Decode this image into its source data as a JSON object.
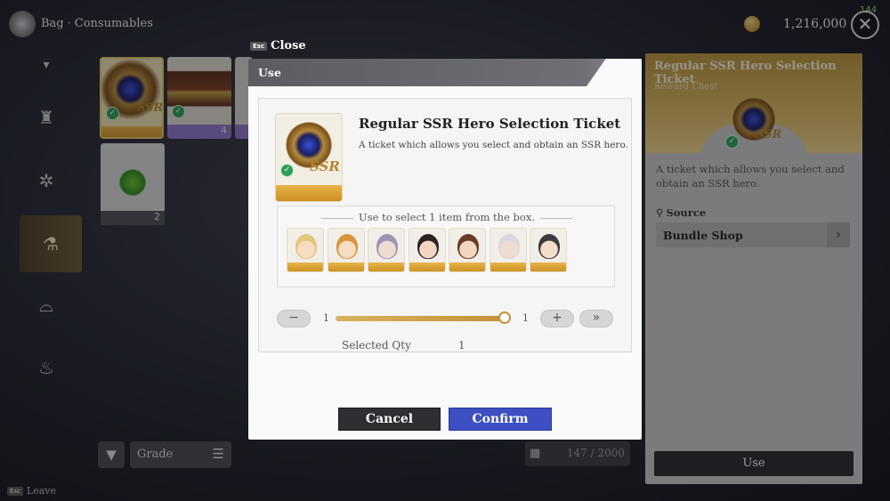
{
  "header": {
    "breadcrumb_root": "Bag",
    "breadcrumb_separator": "·",
    "breadcrumb_current": "Consumables",
    "gold_amount": "1,216,000",
    "exit_counter": "144",
    "exit_glyph": "✕"
  },
  "sidebar": {
    "items": [
      {
        "icon": "chevron-down-icon",
        "glyph": "▾"
      },
      {
        "icon": "armor-icon",
        "glyph": "♜"
      },
      {
        "icon": "gear-icon",
        "glyph": "✲"
      },
      {
        "icon": "potion-icon",
        "glyph": "⚗"
      },
      {
        "icon": "cloche-icon",
        "glyph": "⌓"
      },
      {
        "icon": "bag-icon",
        "glyph": "♨"
      }
    ]
  },
  "inventory": {
    "items": [
      {
        "name": "ssr-ticket",
        "qty": "",
        "selected": true,
        "badge": "SSR"
      },
      {
        "name": "treasure-chest",
        "qty": "4",
        "selected": false
      },
      {
        "name": "partial-item",
        "qty": "",
        "selected": false
      },
      {
        "name": "green-potion",
        "qty": "2",
        "selected": false
      }
    ]
  },
  "filter": {
    "filter_glyph": "▼",
    "grade_label": "Grade",
    "sort_glyph": "☰",
    "grid_glyph": "▦",
    "count": "147 / 2000"
  },
  "footer": {
    "key_label": "Esc",
    "leave_label": "Leave"
  },
  "close": {
    "key_label": "Esc",
    "label": "Close"
  },
  "dialog": {
    "title": "Use",
    "item_name": "Regular SSR Hero Selection Ticket",
    "item_desc": "A ticket which allows you select and obtain an SSR hero.",
    "badge": "SSR",
    "select_label": "Use to select 1 item from the box.",
    "heroes": [
      {
        "name": "blonde-hero",
        "hair": "#e3c77d",
        "skin": "#f6dcc0"
      },
      {
        "name": "ginger-hero",
        "hair": "#d9953c",
        "skin": "#f6dcc0"
      },
      {
        "name": "silver-hero",
        "hair": "#9d94b3",
        "skin": "#efdbd0"
      },
      {
        "name": "dark-hair-hero",
        "hair": "#2c2325",
        "skin": "#f3d6c2"
      },
      {
        "name": "brown-hair-hero",
        "hair": "#6a3a25",
        "skin": "#f3d6c2"
      },
      {
        "name": "white-hair-hero",
        "hair": "#d8d8e0",
        "skin": "#efdbd0"
      },
      {
        "name": "hat-hero",
        "hair": "#3b3b3f",
        "skin": "#f3dcc8"
      }
    ],
    "minus_glyph": "−",
    "plus_glyph": "+",
    "max_glyph": "»",
    "min_value": "1",
    "max_value": "1",
    "slider_fraction": 1.0,
    "selected_qty_label": "Selected Qty",
    "selected_qty_value": "1",
    "cancel_label": "Cancel",
    "confirm_label": "Confirm"
  },
  "detail_panel": {
    "title": "Regular SSR Hero Selection Ticket",
    "subtitle": "Reward Chest",
    "badge": "SSR",
    "description": "A ticket which allows you select and obtain an SSR hero.",
    "source_label": "Source",
    "source_glyph": "⚲",
    "source_item": "Bundle Shop",
    "source_arrow": "›",
    "use_label": "Use"
  },
  "colors": {
    "accent_gold": "#c39238",
    "confirm_blue": "#3d4fc2",
    "check_green": "#2f9d57"
  }
}
